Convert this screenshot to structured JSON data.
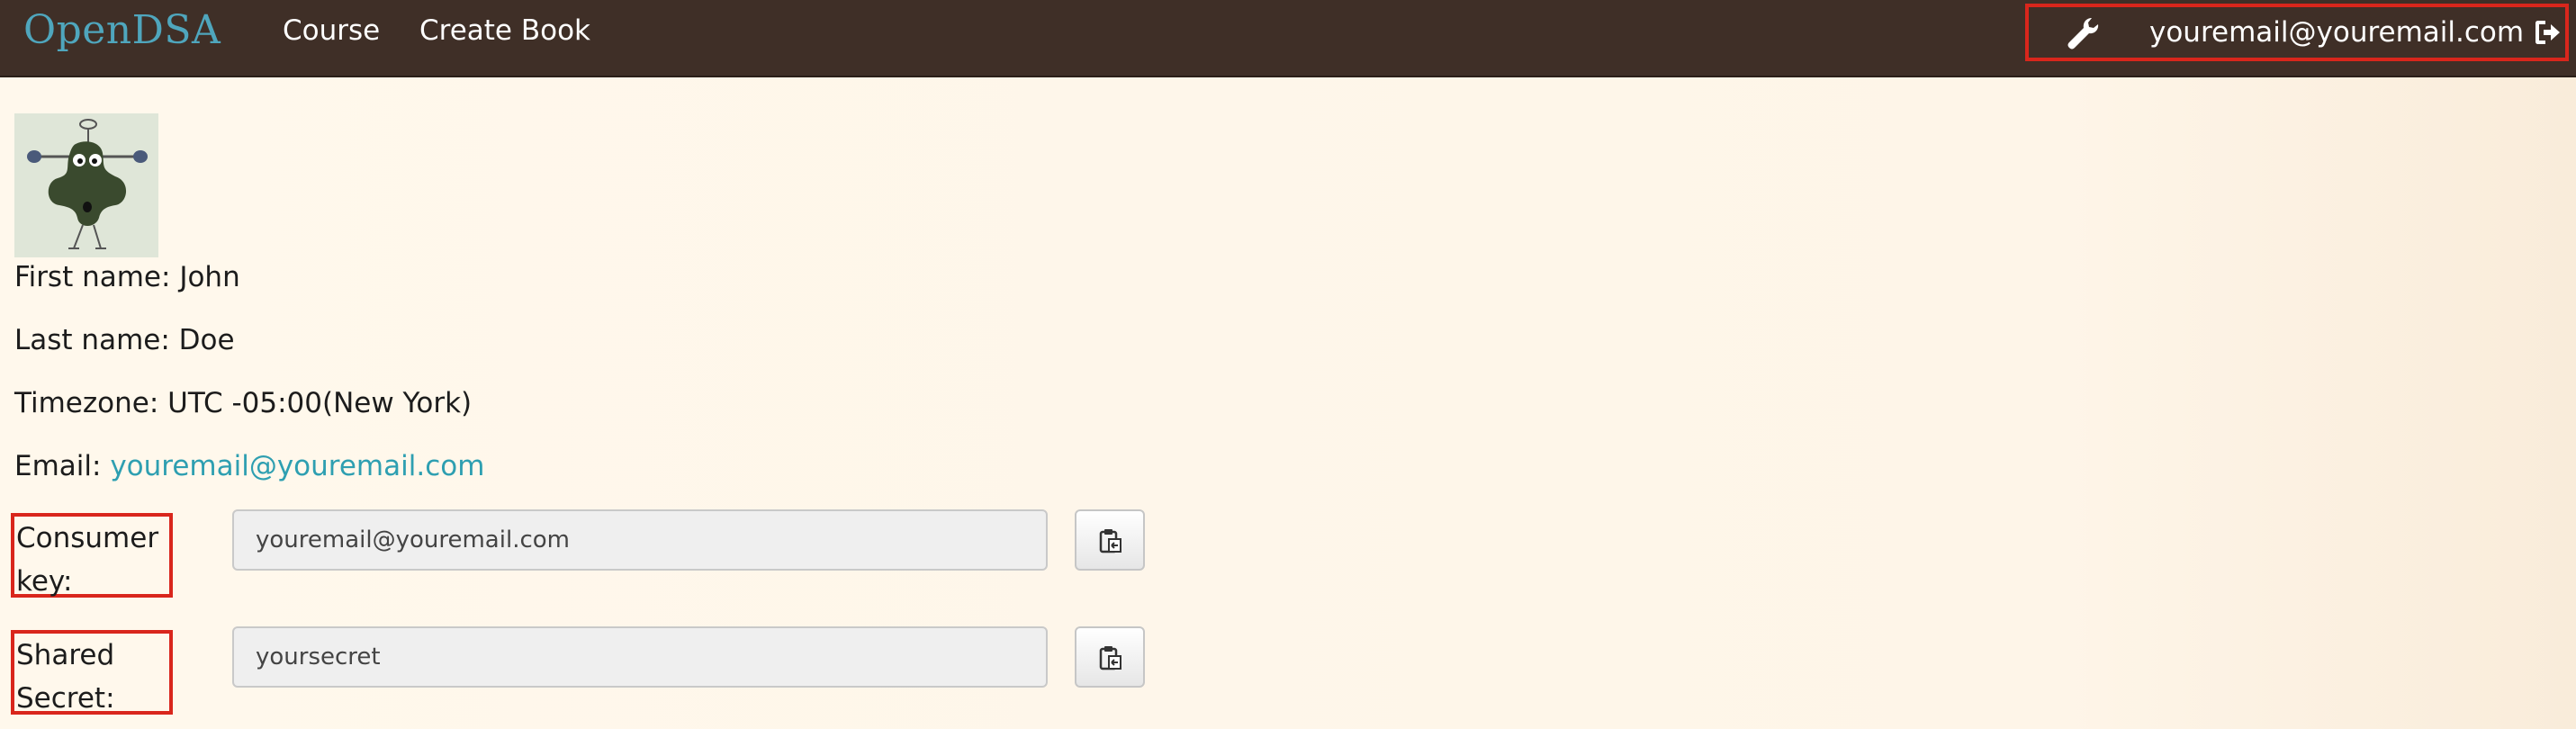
{
  "navbar": {
    "brand": "OpenDSA",
    "links": [
      {
        "label": "Course"
      },
      {
        "label": "Create Book"
      }
    ],
    "user_email": "youremail@youremail.com",
    "icons": [
      "wrench-icon",
      "logout-icon"
    ]
  },
  "profile": {
    "first_name": {
      "label": "First name:",
      "value": "John"
    },
    "last_name": {
      "label": "Last name:",
      "value": "Doe"
    },
    "timezone": {
      "label": "Timezone:",
      "value": "UTC -05:00(New York)"
    },
    "email": {
      "label": "Email:",
      "value": "youremail@youremail.com"
    }
  },
  "keys": {
    "consumer": {
      "label_line1": "Consumer",
      "label_line2": "key:",
      "value": "youremail@youremail.com"
    },
    "shared": {
      "label_line1": "Shared",
      "label_line2": "Secret:",
      "value": "yoursecret"
    }
  },
  "colors": {
    "navbar_bg": "#3f2f27",
    "brand": "#4fa6bd",
    "link": "#2e9fb1",
    "highlight_box": "#d9261c",
    "page_bg": "#fff8ec"
  }
}
